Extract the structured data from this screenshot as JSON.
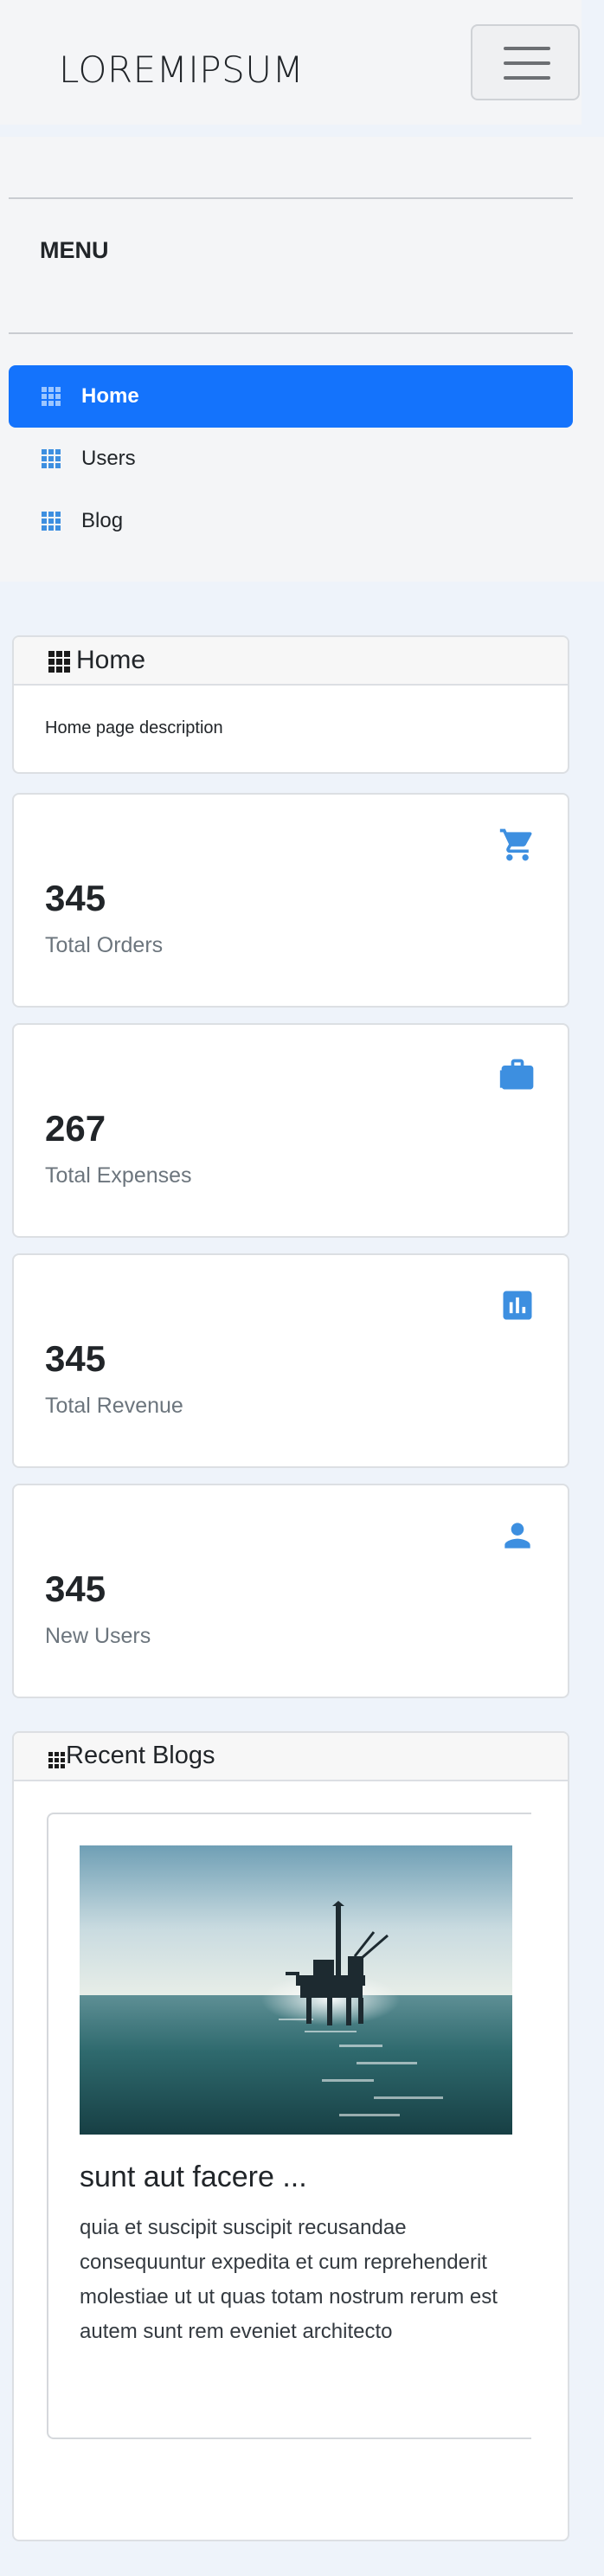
{
  "header": {
    "brand": "LOREMIPSUM",
    "menu_button_icon": "hamburger-icon"
  },
  "sidebar": {
    "title": "MENU",
    "items": [
      {
        "label": "Home",
        "icon": "grid-icon",
        "active": true
      },
      {
        "label": "Users",
        "icon": "grid-icon",
        "active": false
      },
      {
        "label": "Blog",
        "icon": "grid-icon",
        "active": false
      }
    ]
  },
  "home_card": {
    "title": "Home",
    "description": "Home page description"
  },
  "stats": [
    {
      "value": "345",
      "label": "Total Orders",
      "icon": "cart-icon"
    },
    {
      "value": "267",
      "label": "Total Expenses",
      "icon": "briefcase-icon"
    },
    {
      "value": "345",
      "label": "Total Revenue",
      "icon": "bar-chart-icon"
    },
    {
      "value": "345",
      "label": "New Users",
      "icon": "person-icon"
    }
  ],
  "blogs": {
    "title": "Recent Blogs",
    "items": [
      {
        "title": "sunt aut facere ...",
        "body": "quia et suscipit suscipit recusandae consequuntur expedita et cum reprehenderit molestiae ut ut quas totam nostrum rerum est autem sunt rem eveniet architecto",
        "image": "offshore-oil-rig"
      }
    ]
  },
  "colors": {
    "accent": "#1473fc",
    "icon": "#3d8fe0",
    "background": "#eef3fa"
  }
}
